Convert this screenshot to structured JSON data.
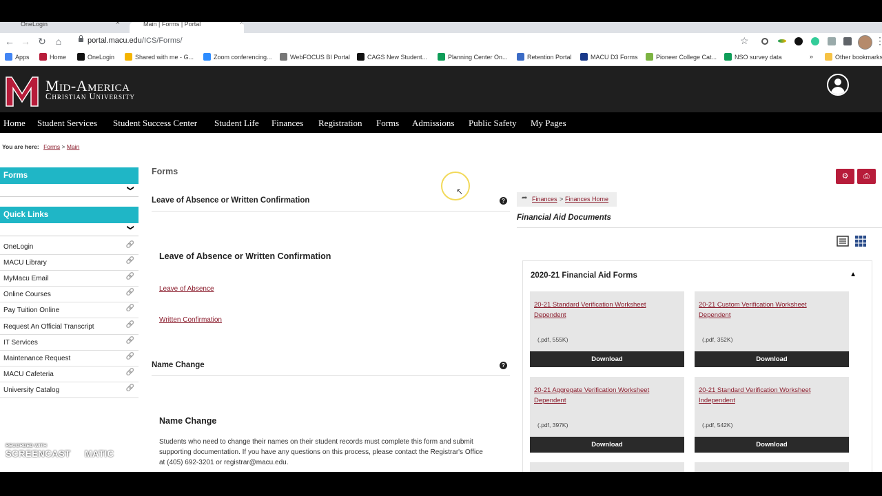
{
  "browser": {
    "tabs": [
      {
        "title": "OneLogin",
        "active": false
      },
      {
        "title": "Main | Forms | Portal",
        "active": true
      }
    ],
    "url_host": "portal.macu.edu",
    "url_path": "/ICS/Forms/",
    "bookmarks": [
      {
        "label": "Apps",
        "icon": "apps-grid-icon",
        "color": "#4285f4"
      },
      {
        "label": "Home",
        "icon": "macu-m-icon",
        "color": "#b71c3a"
      },
      {
        "label": "OneLogin",
        "icon": "onelogin-icon",
        "color": "#111111"
      },
      {
        "label": "Shared with me - G...",
        "icon": "google-drive-icon",
        "color": "#f4b400"
      },
      {
        "label": "Zoom conferencing...",
        "icon": "zoom-icon",
        "color": "#2d8cff"
      },
      {
        "label": "WebFOCUS BI Portal",
        "icon": "globe-icon",
        "color": "#777777"
      },
      {
        "label": "CAGS New Student...",
        "icon": "p-icon",
        "color": "#111111"
      },
      {
        "label": "Planning Center On...",
        "icon": "sheets-icon",
        "color": "#0f9d58"
      },
      {
        "label": "Retention Portal",
        "icon": "calendar-icon",
        "color": "#3b6bc5"
      },
      {
        "label": "MACU D3 Forms",
        "icon": "form-icon",
        "color": "#1a3a8a"
      },
      {
        "label": "Pioneer College Cat...",
        "icon": "circle-icon",
        "color": "#7cb342"
      },
      {
        "label": "NSO survey data",
        "icon": "nso-icon",
        "color": "#0f9d58"
      },
      {
        "label": "Other bookmarks",
        "icon": "folder-icon",
        "color": "#f6c244"
      }
    ],
    "more_bookmarks": "»"
  },
  "header": {
    "logo_line1": "Mid-America",
    "logo_line2": "Christian University"
  },
  "nav": [
    "Home",
    "Student Services",
    "Student Success Center",
    "Student Life",
    "Finances",
    "Registration",
    "Forms",
    "Admissions",
    "Public Safety",
    "My Pages"
  ],
  "breadcrumb": {
    "label": "You are here:",
    "items": [
      "Forms",
      "Main"
    ],
    "separator": ">"
  },
  "sidebar": {
    "forms_title": "Forms",
    "quicklinks_title": "Quick Links",
    "links": [
      "OneLogin",
      "MACU Library",
      "MyMacu Email",
      "Online Courses",
      "Pay Tuition Online",
      "Request An Official Transcript",
      "IT Services",
      "Maintenance Request",
      "MACU Cafeteria",
      "University Catalog"
    ]
  },
  "main": {
    "title": "Forms",
    "loa": {
      "box_title": "Leave of Absence or Written Confirmation",
      "heading": "Leave of Absence or Written Confirmation",
      "links": [
        "Leave of Absence",
        "Written Confirmation"
      ]
    },
    "name_change": {
      "box_title": "Name Change",
      "heading": "Name Change",
      "text_line1": "Students who need to change their names on their student records must complete this form and submit",
      "text_line2": "supporting documentation. If you have any questions on this process, please contact the Registrar's Office",
      "text_line3": "at (405) 692-3201 or registrar@macu.edu."
    }
  },
  "right": {
    "crumb": [
      "Finances",
      "Finances Home"
    ],
    "crumb_separator": ">",
    "section_title": "Financial Aid Documents",
    "panel_title": "2020-21 Financial Aid Forms",
    "download_label": "Download",
    "cards": [
      {
        "title": "20-21 Standard Verification Worksheet Dependent",
        "meta": "(.pdf, 555K)"
      },
      {
        "title": "20-21 Custom Verification Worksheet Dependent",
        "meta": "(.pdf, 352K)"
      },
      {
        "title": "20-21 Aggregate Verification Worksheet Dependent",
        "meta": "(.pdf, 397K)"
      },
      {
        "title": "20-21 Standard Verification Worksheet Independent",
        "meta": "(.pdf, 542K)"
      }
    ]
  },
  "watermark": {
    "line1": "RECORDED WITH",
    "line2": "SCREENCAST",
    "line3": "MATIC"
  },
  "colors": {
    "accent": "#1fb6c6",
    "brand": "#b71c3a",
    "link": "#8a1b2b",
    "header": "#1f1f1f"
  }
}
